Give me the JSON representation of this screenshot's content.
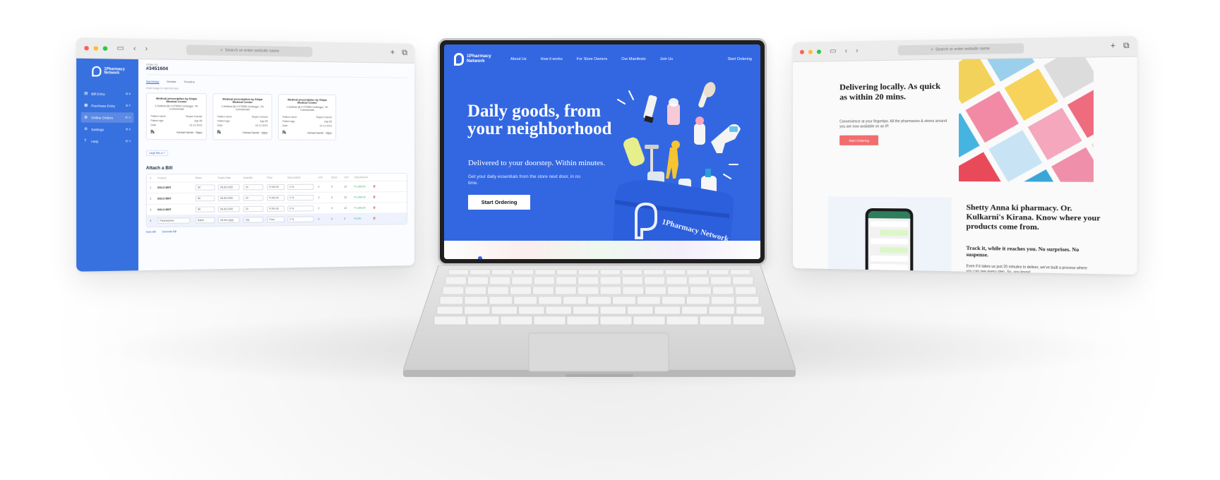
{
  "colors": {
    "brand_blue": "#3367e2",
    "sidebar_blue": "#3770df",
    "coral": "#f26d6d",
    "silver": "#d5d5d5"
  },
  "browser": {
    "address_placeholder": "Search or enter website name"
  },
  "left_window": {
    "sidebar": {
      "brand": "1Pharmacy Network",
      "items": [
        {
          "label": "Bill Entry",
          "icon": "receipt-icon",
          "shortcut": "⌘ B"
        },
        {
          "label": "Purchase Entry",
          "icon": "cart-icon",
          "shortcut": "⌘ P"
        },
        {
          "label": "Online Orders",
          "icon": "globe-icon",
          "shortcut": "⌘ O"
        },
        {
          "label": "Settings",
          "icon": "gear-icon",
          "shortcut": "⌘ S"
        },
        {
          "label": "Help",
          "icon": "help-icon",
          "shortcut": "⌘ H"
        }
      ]
    },
    "order_small": "Order Id",
    "order_id": "#3451604",
    "tabs": [
      "Summary",
      "Details",
      "Timeline"
    ],
    "hint": "Click image to view full size",
    "prescriptions": [
      {
        "title": "Medical prescription by Shipa Medical Center",
        "clinic": "1,Gulshan Ijk 4 ST9999 Centergpx, 7th Commercials",
        "patient_label": "Patient name:",
        "patient": "Shyam Sundar",
        "doctor_label": "Patient age:",
        "doctor": "Age 68",
        "date_label": "Date:",
        "date": "02-12-2023",
        "rx": "℞",
        "sign": "Farhad Hamid · Signy"
      },
      {
        "title": "Medical prescription by Shipa Medical Center",
        "clinic": "1,Gulshan Ijk 4 ST9999 Centergpx, 7th Commercials",
        "patient_label": "Patient name:",
        "patient": "Shyam Sundar",
        "doctor_label": "Patient age:",
        "doctor": "Age 68",
        "date_label": "Date:",
        "date": "02-12-2023",
        "rx": "℞",
        "sign": "Farhad Hamid · Signy"
      },
      {
        "title": "Medical prescription by Shipa Medical Center",
        "clinic": "1,Gulshan Ijk 4 ST9999 Centergpx, 7th Commercials",
        "patient_label": "Patient name:",
        "patient": "Shyam Sundar",
        "doctor_label": "Patient age:",
        "doctor": "Age 68",
        "date_label": "Date:",
        "date": "02-12-2023",
        "rx": "℞",
        "sign": "Farhad Hamid · Signy"
      }
    ],
    "chip": "Large files  ⊕  +",
    "attach_title": "Attach a Bill",
    "table_headers": [
      "#",
      "Product",
      "Batch",
      "Expiry Date",
      "Quantity",
      "Price",
      "Discount(%)",
      "Unit",
      "Stock",
      "GST",
      "Total Amount",
      ""
    ],
    "rows": [
      {
        "n": "1",
        "product": "DOLO 650T",
        "batch": "50",
        "expiry": "06-30-2025",
        "qty": "20",
        "price": "₹ 200.00",
        "disc": "0 %",
        "unit": "0",
        "stock": "0",
        "gst": "12",
        "total": "₹ 1,600.00",
        "del": "🗑"
      },
      {
        "n": "2",
        "product": "DOLO 650T",
        "batch": "50",
        "expiry": "06-30-2025",
        "qty": "20",
        "price": "₹ 200.00",
        "disc": "0 %",
        "unit": "0",
        "stock": "0",
        "gst": "12",
        "total": "₹ 1,600.00",
        "del": "🗑"
      },
      {
        "n": "3",
        "product": "DOLO 650T",
        "batch": "50",
        "expiry": "06-30-2025",
        "qty": "20",
        "price": "₹ 200.00",
        "disc": "0 %",
        "unit": "0",
        "stock": "0",
        "gst": "12",
        "total": "₹ 1,600.00",
        "del": "🗑"
      },
      {
        "n": "4",
        "product": "Paracetamol",
        "batch": "Batch",
        "expiry": "dd-mm-yyyy",
        "qty": "Qty",
        "price": "Price",
        "disc": "0 %",
        "unit": "0",
        "stock": "0",
        "gst": "0",
        "total": "₹ 0.00",
        "del": "🗑"
      }
    ],
    "footer": [
      "Save Bill",
      "Generate Bill"
    ]
  },
  "laptop": {
    "brand": "1Pharmacy Network",
    "nav": [
      "About Us",
      "How it works",
      "For Store Owners",
      "Our Manifesto",
      "Join Us"
    ],
    "nav_cta": "Start Ordering",
    "headline": "Daily goods, from your neighborhood",
    "subheadline": "Delivered to your doorstep. Within minutes.",
    "body": "Get your daily essentials from the store next door, in no time.",
    "cta": "Start Ordering",
    "bag_brand": "1Pharmacy Network"
  },
  "right_window": {
    "hero_title": "Delivering locally. As quick as within 20 mins.",
    "hero_sub": "Convenience at your fingertips. All the pharmacies & stores around you are now available on an IP.",
    "hero_btn": "Start Ordering",
    "section_title": "Shetty Anna ki pharmacy. Or. Kulkarni's Kirana. Know where your products come from.",
    "section_sub": "Track it, while it reaches you. No surprises. No suspense.",
    "section_body": "Even if it takes us just 20 minutes to deliver, we've built a process where you can see every step. So, you know!"
  }
}
